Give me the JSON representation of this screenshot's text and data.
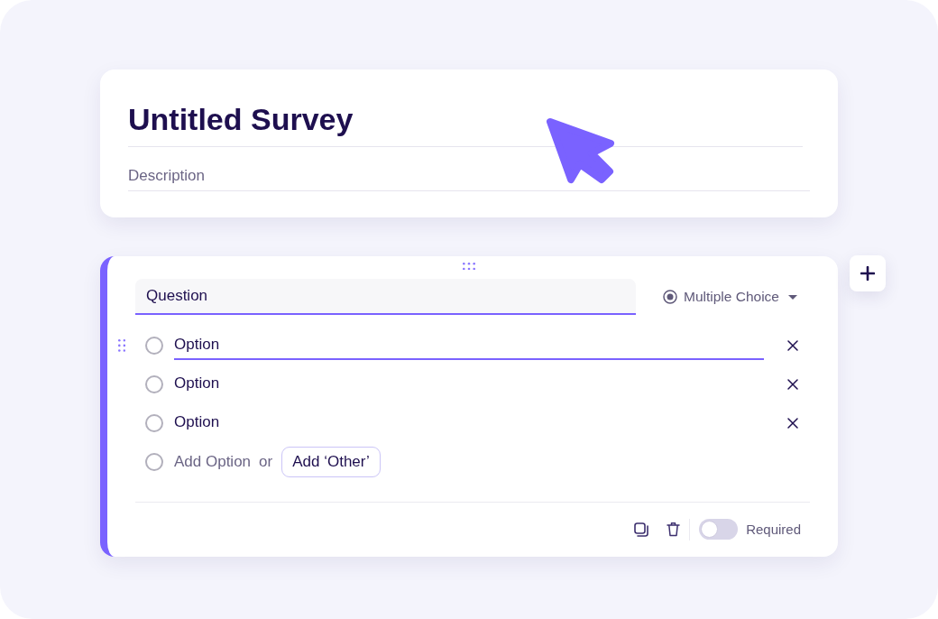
{
  "header": {
    "title": "Untitled Survey",
    "description": {
      "placeholder": "Description"
    }
  },
  "question": {
    "text": "Question",
    "type_selector": {
      "label": "Multiple Choice"
    },
    "options": [
      {
        "label": "Option",
        "focused": true
      },
      {
        "label": "Option",
        "focused": false
      },
      {
        "label": "Option",
        "focused": false
      }
    ],
    "add_option": {
      "label": "Add Option",
      "separator": "or",
      "other_button": "Add ‘Other’"
    },
    "required": {
      "label": "Required",
      "on": false
    }
  }
}
